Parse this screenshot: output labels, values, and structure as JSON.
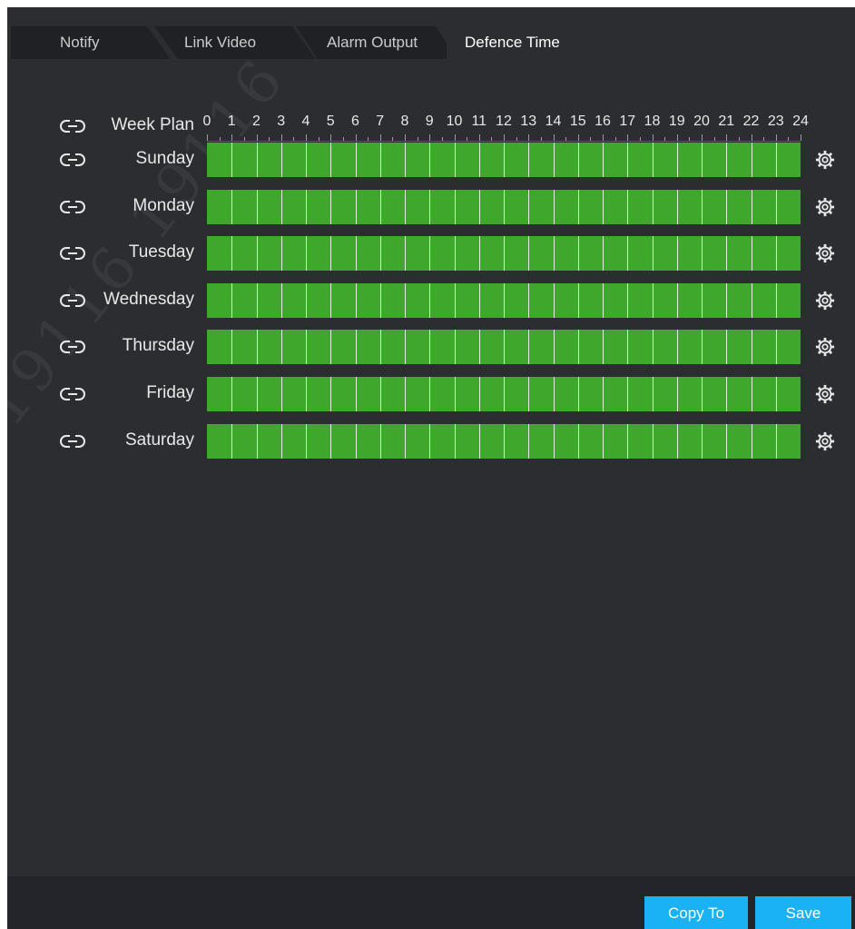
{
  "tabs": [
    {
      "label": "Notify",
      "active": false
    },
    {
      "label": "Link Video",
      "active": false
    },
    {
      "label": "Alarm Output",
      "active": false
    },
    {
      "label": "Defence Time",
      "active": true
    }
  ],
  "schedule": {
    "header_label": "Week Plan",
    "hours": [
      "0",
      "1",
      "2",
      "3",
      "4",
      "5",
      "6",
      "7",
      "8",
      "9",
      "10",
      "11",
      "12",
      "13",
      "14",
      "15",
      "16",
      "17",
      "18",
      "19",
      "20",
      "21",
      "22",
      "23",
      "24"
    ],
    "days": [
      {
        "label": "Sunday",
        "armed_from": 0,
        "armed_to": 24
      },
      {
        "label": "Monday",
        "armed_from": 0,
        "armed_to": 24
      },
      {
        "label": "Tuesday",
        "armed_from": 0,
        "armed_to": 24
      },
      {
        "label": "Wednesday",
        "armed_from": 0,
        "armed_to": 24
      },
      {
        "label": "Thursday",
        "armed_from": 0,
        "armed_to": 24
      },
      {
        "label": "Friday",
        "armed_from": 0,
        "armed_to": 24
      },
      {
        "label": "Saturday",
        "armed_from": 0,
        "armed_to": 24
      }
    ],
    "armed_color": "#3fa82c"
  },
  "icons": {
    "link": "link-icon",
    "settings": "gear-icon"
  },
  "watermark": "19116 19116 19116 19116",
  "footer": {
    "copy_label": "Copy To",
    "save_label": "Save"
  },
  "colors": {
    "accent": "#1ab2f2",
    "background": "#2b2d30"
  }
}
